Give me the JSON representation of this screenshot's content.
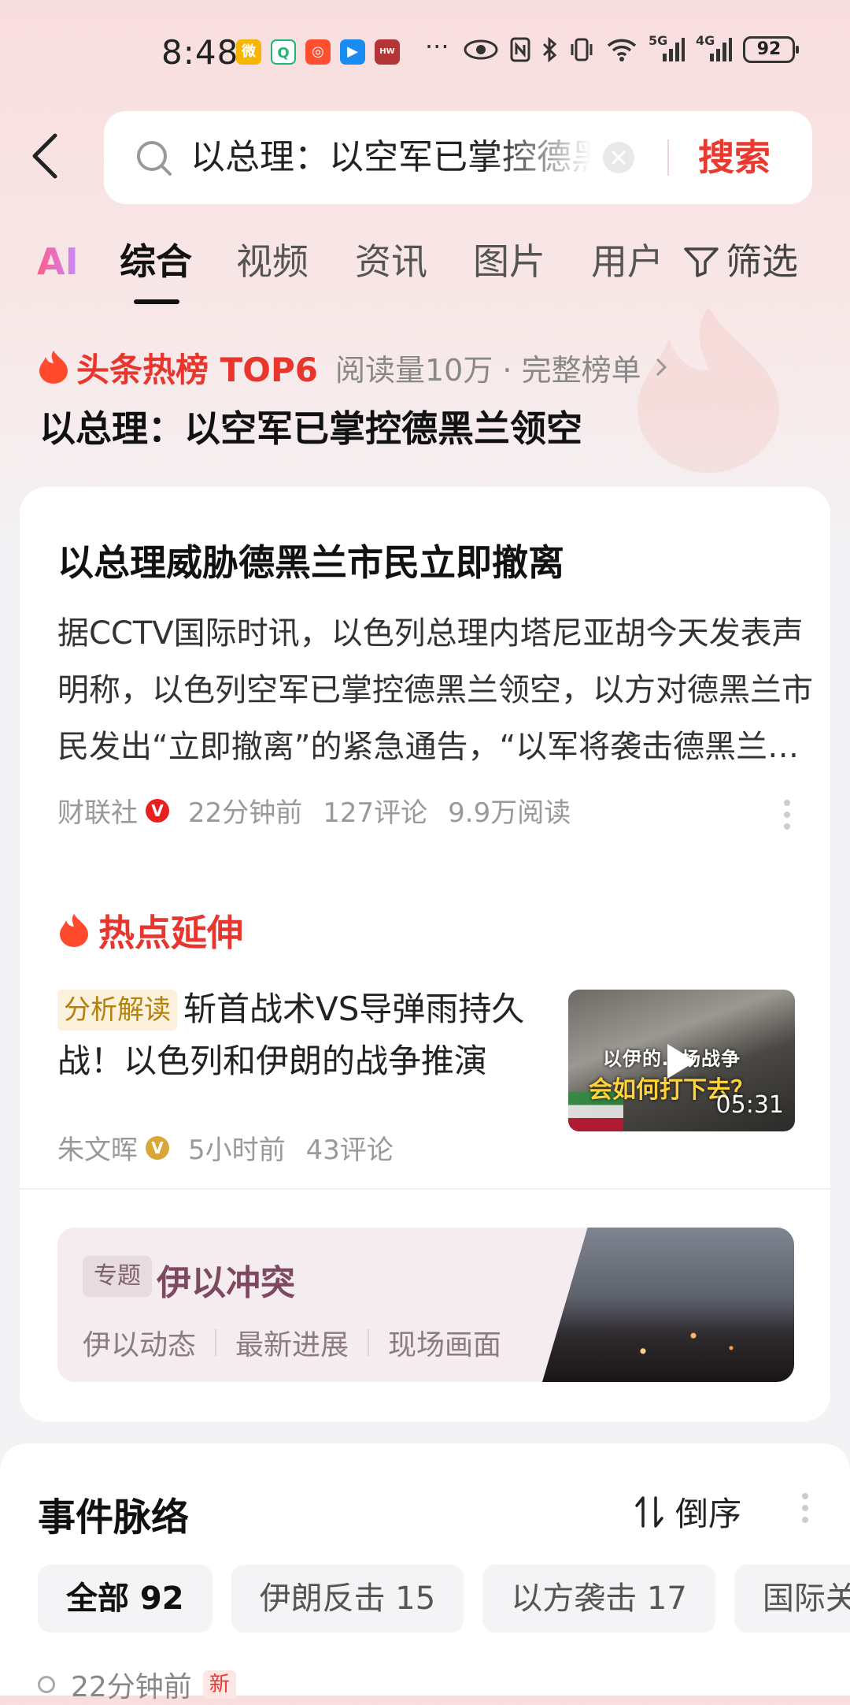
{
  "status_bar": {
    "time": "8:48",
    "battery": "92",
    "network_5g": "5G",
    "network_4g": "4G",
    "more": "···"
  },
  "search": {
    "query": "以总理：以空军已掌控德黑兰领空",
    "button": "搜索"
  },
  "tabs": {
    "ai": "AI",
    "items": [
      "综合",
      "视频",
      "资讯",
      "图片",
      "用户"
    ],
    "filter": "筛选"
  },
  "hot": {
    "label": "头条热榜 TOP6",
    "meta": "阅读量10万 · 完整榜单",
    "headline": "以总理：以空军已掌控德黑兰领空"
  },
  "article": {
    "title": "以总理威胁德黑兰市民立即撤离",
    "body": "据CCTV国际时讯，以色列总理内塔尼亚胡今天发表声明称，以色列空军已掌控德黑兰领空，以方对德黑兰市民发出“立即撤离”的紧急通告，“以军将袭击德黑兰的目标”。",
    "source": "财联社",
    "time": "22分钟前",
    "comments": "127评论",
    "reads": "9.9万阅读"
  },
  "extension": {
    "title": "热点延伸",
    "tag": "分析解读",
    "headline": "斩首战术VS导弹雨持久战！以色列和伊朗的战争推演",
    "author": "朱文晖",
    "time": "5小时前",
    "comments": "43评论",
    "thumb_caption_top": "以伊的…场战争",
    "thumb_caption_bottom": "会如何打下去？",
    "duration": "05:31"
  },
  "topic": {
    "tag": "专题",
    "title": "伊以冲突",
    "links": [
      "伊以动态",
      "最新进展",
      "现场画面"
    ]
  },
  "timeline": {
    "title": "事件脉络",
    "sort": "倒序",
    "chips": [
      "全部 92",
      "伊朗反击 15",
      "以方袭击 17",
      "国际关"
    ],
    "first_entry_time": "22分钟前",
    "new_badge": "新"
  },
  "colors": {
    "accent_red": "#e8362e",
    "topic_title": "#7d4960",
    "verified_red": "#e82020",
    "verified_gold": "#d9a63a"
  }
}
